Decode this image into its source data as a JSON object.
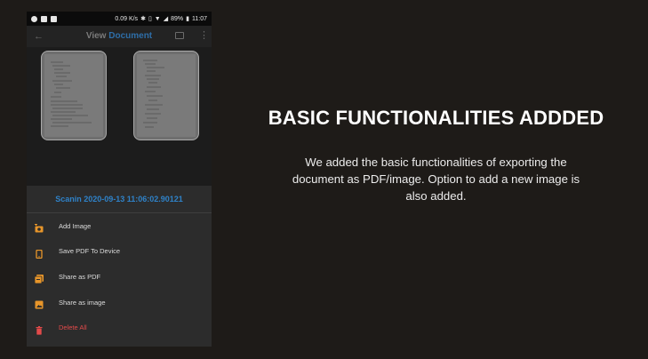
{
  "status_bar": {
    "speed": "0.09 K/s",
    "battery": "89%",
    "time": "11:07"
  },
  "app_bar": {
    "title_prefix": "View",
    "title_accent": "Document",
    "back_icon": "arrow-left-icon",
    "gallery_icon": "gallery-icon",
    "more_icon": "more-vertical-icon"
  },
  "documents": [
    {
      "name": "scanned-page-1"
    },
    {
      "name": "scanned-page-2"
    }
  ],
  "bottom_sheet": {
    "title": "Scanin 2020-09-13 11:06:02.90121",
    "items": [
      {
        "label": "Add Image",
        "icon": "camera-plus-icon"
      },
      {
        "label": "Save PDF To Device",
        "icon": "phone-icon"
      },
      {
        "label": "Share as PDF",
        "icon": "pdf-icon"
      },
      {
        "label": "Share as image",
        "icon": "image-icon"
      },
      {
        "label": "Delete All",
        "icon": "trash-icon"
      }
    ]
  },
  "colors": {
    "accent": "#2f82c8",
    "icon_orange": "#e8962a",
    "danger": "#e24a4a",
    "background": "#1e1b18"
  },
  "hero": {
    "heading": "BASIC FUNCTIONALITIES ADDDED",
    "description": "We added the basic functionalities of exporting the document as PDF/image. Option to add a new image is also added."
  }
}
